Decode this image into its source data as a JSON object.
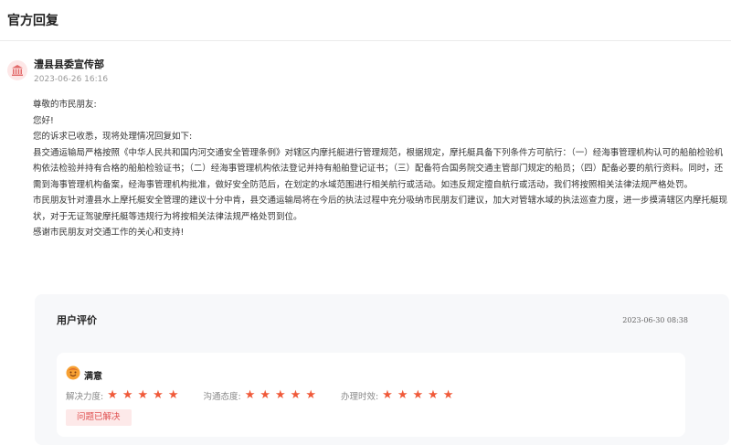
{
  "section": {
    "title": "官方回复"
  },
  "author": {
    "name": "澧县县委宣传部",
    "time": "2023-06-26 16:16",
    "avatar_icon": "government-building-icon"
  },
  "reply": {
    "paragraphs": [
      "尊敬的市民朋友:",
      "您好!",
      "您的诉求已收悉，现将处理情况回复如下:",
      "县交通运输局严格按照《中华人民共和国内河交通安全管理条例》对辖区内摩托艇进行管理规范，根据规定，摩托艇具备下列条件方可航行：（一）经海事管理机构认可的船舶检验机构依法检验并持有合格的船舶检验证书；（二）经海事管理机构依法登记并持有船舶登记证书；（三）配备符合国务院交通主管部门规定的船员；（四）配备必要的航行资料。同时，还需到海事管理机构备案，经海事管理机构批准，做好安全防范后，在划定的水域范围进行相关航行或活动。如违反规定擅自航行或活动，我们将按照相关法律法规严格处罚。",
      "市民朋友针对澧县水上摩托艇安全管理的建议十分中肯，县交通运输局将在今后的执法过程中充分吸纳市民朋友们建议，加大对管辖水域的执法巡查力度，进一步摸清辖区内摩托艇现状，对于无证驾驶摩托艇等违规行为将按相关法律法规严格处罚到位。",
      "感谢市民朋友对交通工作的关心和支持!"
    ]
  },
  "rating": {
    "title": "用户评价",
    "time": "2023-06-30 08:38",
    "satisfaction": "满意",
    "satisfaction_icon": "smiley-face-icon",
    "scores": [
      {
        "label": "解决力度:",
        "stars": 5
      },
      {
        "label": "沟通态度:",
        "stars": 5
      },
      {
        "label": "办理时效:",
        "stars": 5
      }
    ],
    "status_tag": "问题已解决",
    "star_icon": "star-icon",
    "accent_color": "#f05a3a"
  }
}
